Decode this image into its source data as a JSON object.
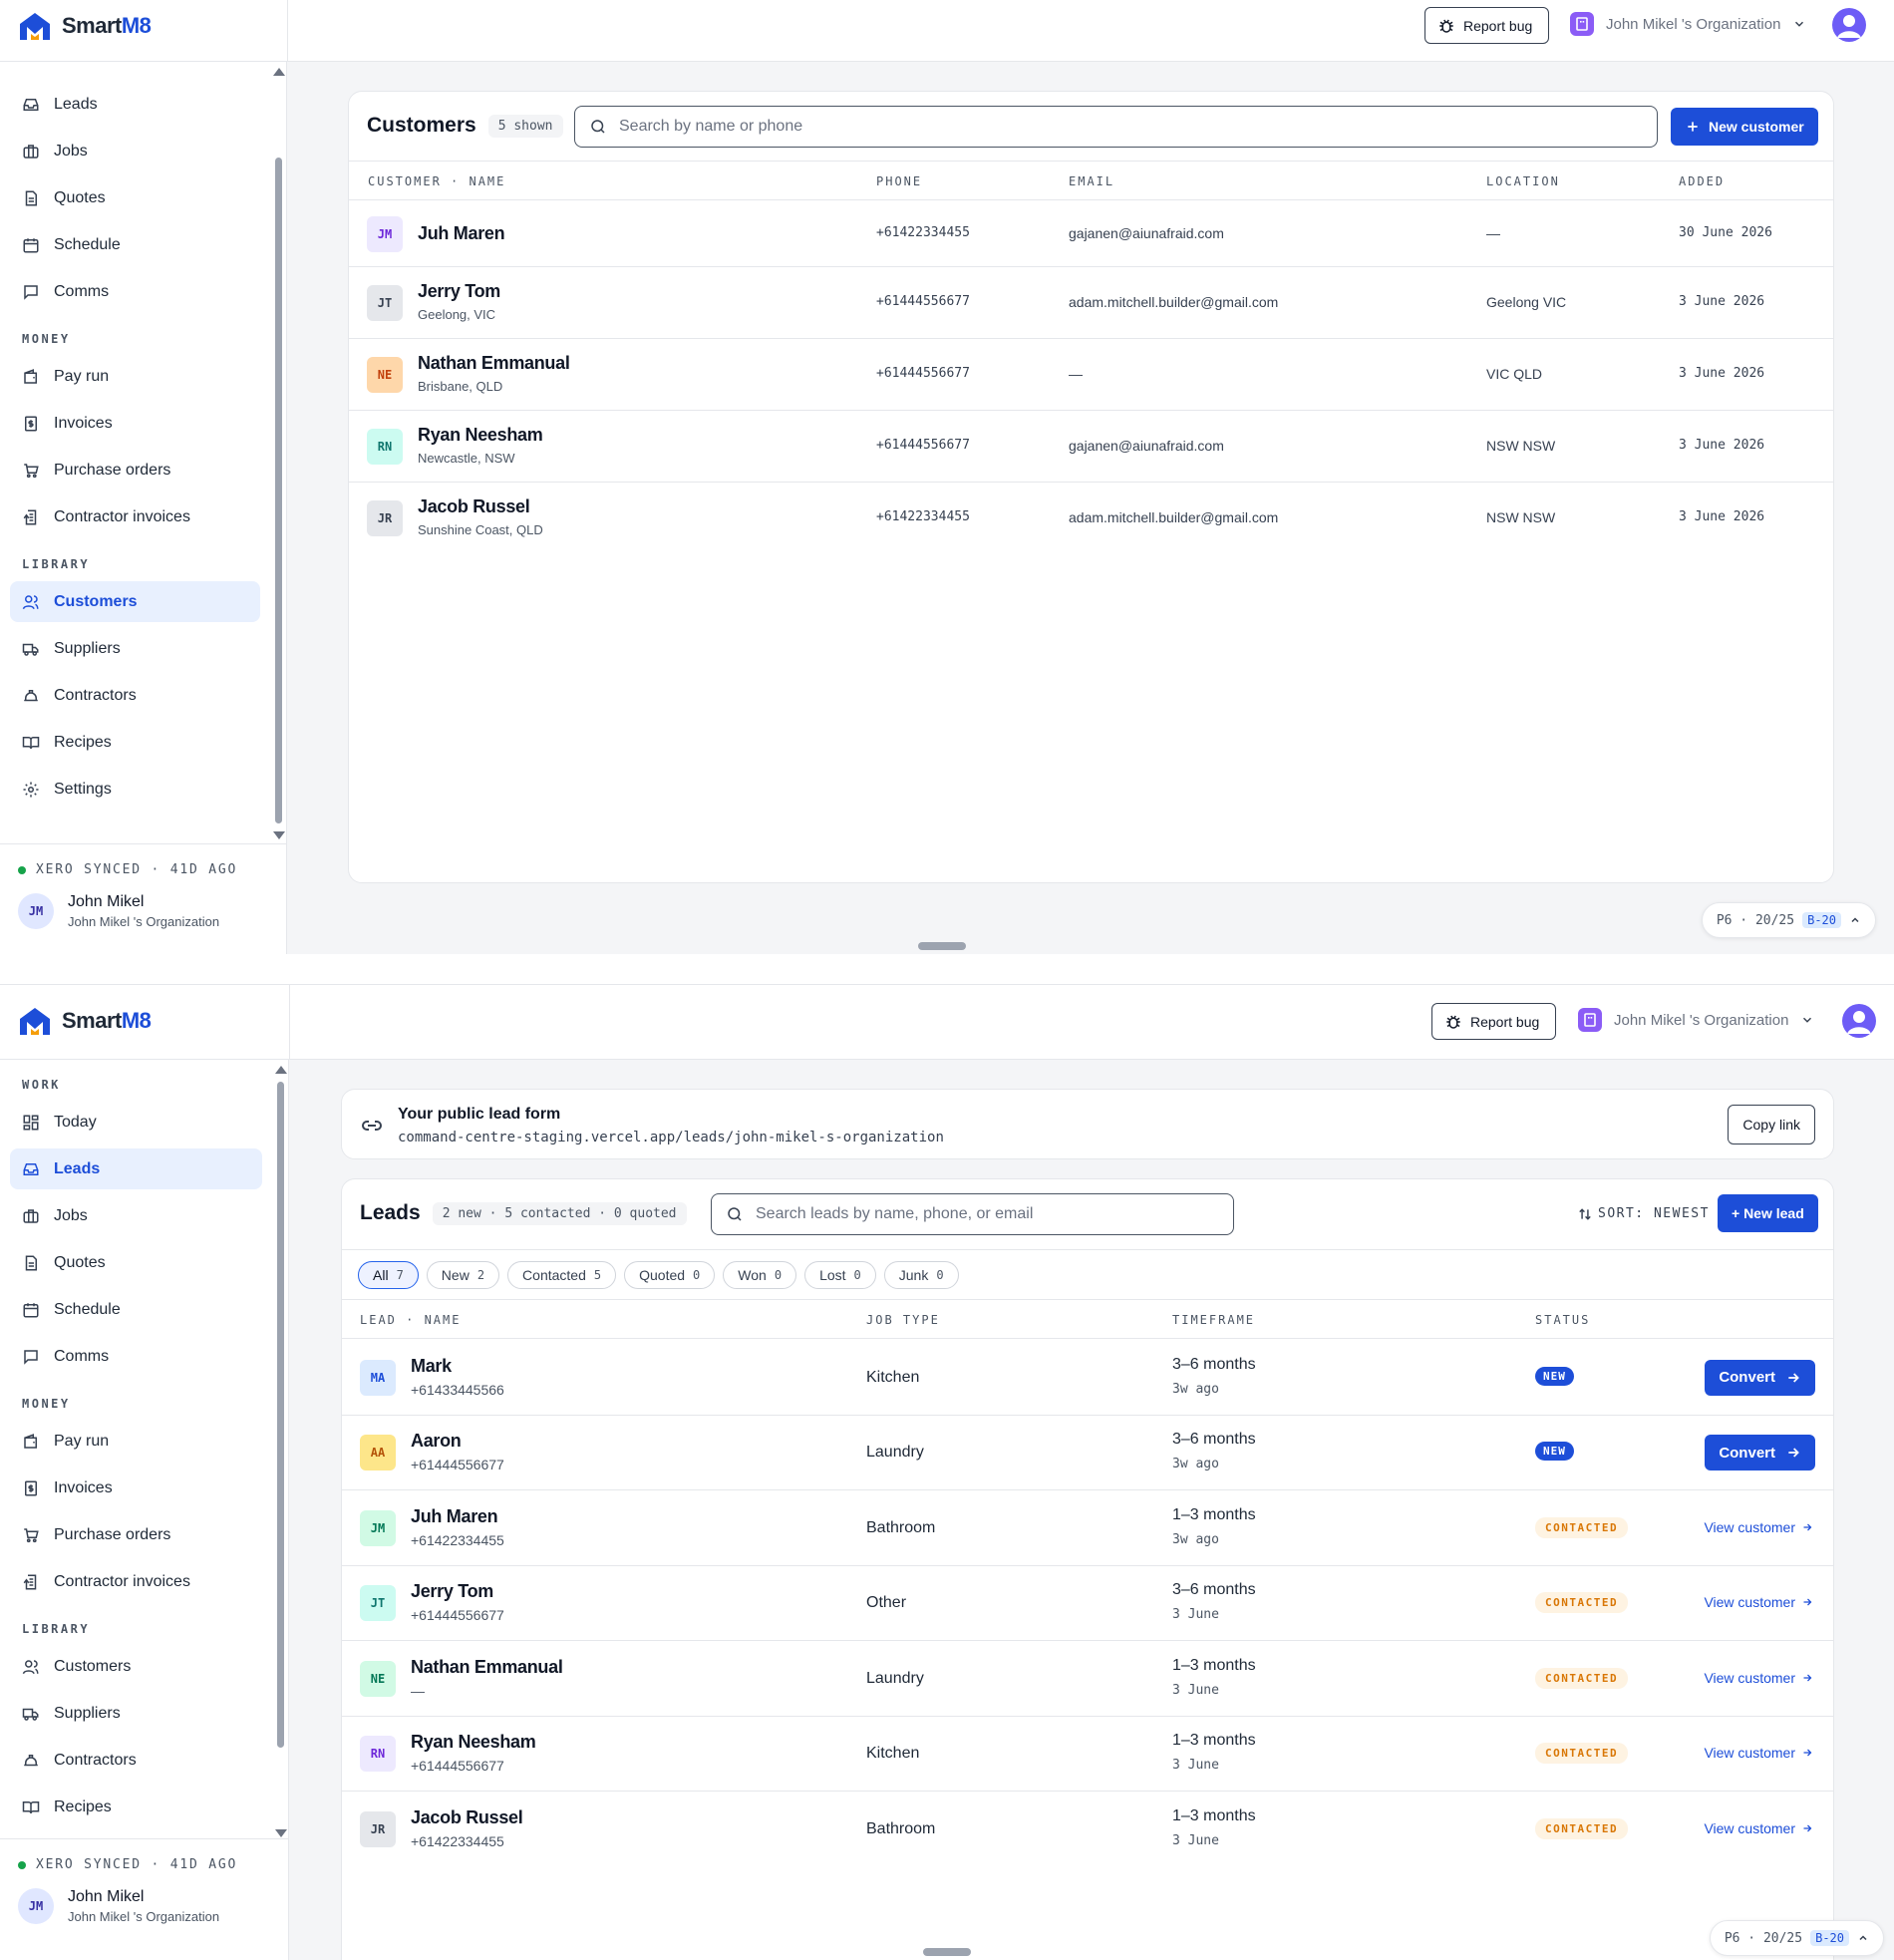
{
  "app": {
    "brand_a": "Smart",
    "brand_b": "M8"
  },
  "topbar": {
    "report_bug": "Report bug",
    "org_name": "John Mikel 's Organization"
  },
  "sidebar": {
    "group_work": "WORK",
    "group_money": "MONEY",
    "group_library": "LIBRARY",
    "today": "Today",
    "leads": "Leads",
    "jobs": "Jobs",
    "quotes": "Quotes",
    "schedule": "Schedule",
    "comms": "Comms",
    "pay_run": "Pay run",
    "invoices": "Invoices",
    "purchase_orders": "Purchase orders",
    "contractor_invoices": "Contractor invoices",
    "customers": "Customers",
    "suppliers": "Suppliers",
    "contractors": "Contractors",
    "recipes": "Recipes",
    "settings": "Settings",
    "xero_status": "XERO SYNCED · 41D AGO",
    "user_initials": "JM",
    "user_name": "John Mikel",
    "user_org": "John Mikel 's Organization"
  },
  "customers_page": {
    "title": "Customers",
    "count": "5 shown",
    "search_placeholder": "Search by name or phone",
    "new_button": "New customer",
    "columns": {
      "name": "CUSTOMER · NAME",
      "phone": "PHONE",
      "email": "EMAIL",
      "location": "LOCATION",
      "added": "ADDED"
    },
    "rows": [
      {
        "initials": "JM",
        "name": "Juh Maren",
        "sub": "",
        "phone": "+61422334455",
        "email": "gajanen@aiunafraid.com",
        "location": "—",
        "added": "30 June 2026"
      },
      {
        "initials": "JT",
        "name": "Jerry Tom",
        "sub": "Geelong, VIC",
        "phone": "+61444556677",
        "email": "adam.mitchell.builder@gmail.com",
        "location": "Geelong VIC",
        "added": "3 June 2026"
      },
      {
        "initials": "NE",
        "name": "Nathan Emmanual",
        "sub": "Brisbane, QLD",
        "phone": "+61444556677",
        "email": "—",
        "location": "VIC QLD",
        "added": "3 June 2026"
      },
      {
        "initials": "RN",
        "name": "Ryan Neesham",
        "sub": "Newcastle, NSW",
        "phone": "+61444556677",
        "email": "gajanen@aiunafraid.com",
        "location": "NSW NSW",
        "added": "3 June 2026"
      },
      {
        "initials": "JR",
        "name": "Jacob Russel",
        "sub": "Sunshine Coast, QLD",
        "phone": "+61422334455",
        "email": "adam.mitchell.builder@gmail.com",
        "location": "NSW NSW",
        "added": "3 June 2026"
      }
    ]
  },
  "debug_chip": {
    "label": "P6 · 20/25",
    "badge": "B-20"
  },
  "leads_page": {
    "form_title": "Your public lead form",
    "form_url": "command-centre-staging.vercel.app/leads/john-mikel-s-organization",
    "copy_link": "Copy link",
    "title": "Leads",
    "summary": "2 new · 5 contacted · 0 quoted",
    "search_placeholder": "Search leads by name, phone, or email",
    "sort_label": "SORT: NEWEST",
    "new_lead": "+ New lead",
    "filters": [
      {
        "label": "All",
        "count": "7"
      },
      {
        "label": "New",
        "count": "2"
      },
      {
        "label": "Contacted",
        "count": "5"
      },
      {
        "label": "Quoted",
        "count": "0"
      },
      {
        "label": "Won",
        "count": "0"
      },
      {
        "label": "Lost",
        "count": "0"
      },
      {
        "label": "Junk",
        "count": "0"
      }
    ],
    "columns": {
      "name": "LEAD · NAME",
      "job_type": "JOB TYPE",
      "timeframe": "TIMEFRAME",
      "status": "STATUS"
    },
    "convert_label": "Convert",
    "view_label": "View customer",
    "rows": [
      {
        "initials": "MA",
        "name": "Mark",
        "phone": "+61433445566",
        "job_type": "Kitchen",
        "timeframe": "3–6 months",
        "ago": "3w ago",
        "status": "NEW"
      },
      {
        "initials": "AA",
        "name": "Aaron",
        "phone": "+61444556677",
        "job_type": "Laundry",
        "timeframe": "3–6 months",
        "ago": "3w ago",
        "status": "NEW"
      },
      {
        "initials": "JM",
        "name": "Juh Maren",
        "phone": "+61422334455",
        "job_type": "Bathroom",
        "timeframe": "1–3 months",
        "ago": "3w ago",
        "status": "CONTACTED"
      },
      {
        "initials": "JT",
        "name": "Jerry Tom",
        "phone": "+61444556677",
        "job_type": "Other",
        "timeframe": "3–6 months",
        "ago": "3 June",
        "status": "CONTACTED"
      },
      {
        "initials": "NE",
        "name": "Nathan Emmanual",
        "phone": "—",
        "job_type": "Laundry",
        "timeframe": "1–3 months",
        "ago": "3 June",
        "status": "CONTACTED"
      },
      {
        "initials": "RN",
        "name": "Ryan Neesham",
        "phone": "+61444556677",
        "job_type": "Kitchen",
        "timeframe": "1–3 months",
        "ago": "3 June",
        "status": "CONTACTED"
      },
      {
        "initials": "JR",
        "name": "Jacob Russel",
        "phone": "+61422334455",
        "job_type": "Bathroom",
        "timeframe": "1–3 months",
        "ago": "3 June",
        "status": "CONTACTED"
      }
    ]
  },
  "colors": {
    "accent": "#1d4ed8",
    "contacted": "#d97706",
    "synced": "#16a34a"
  }
}
